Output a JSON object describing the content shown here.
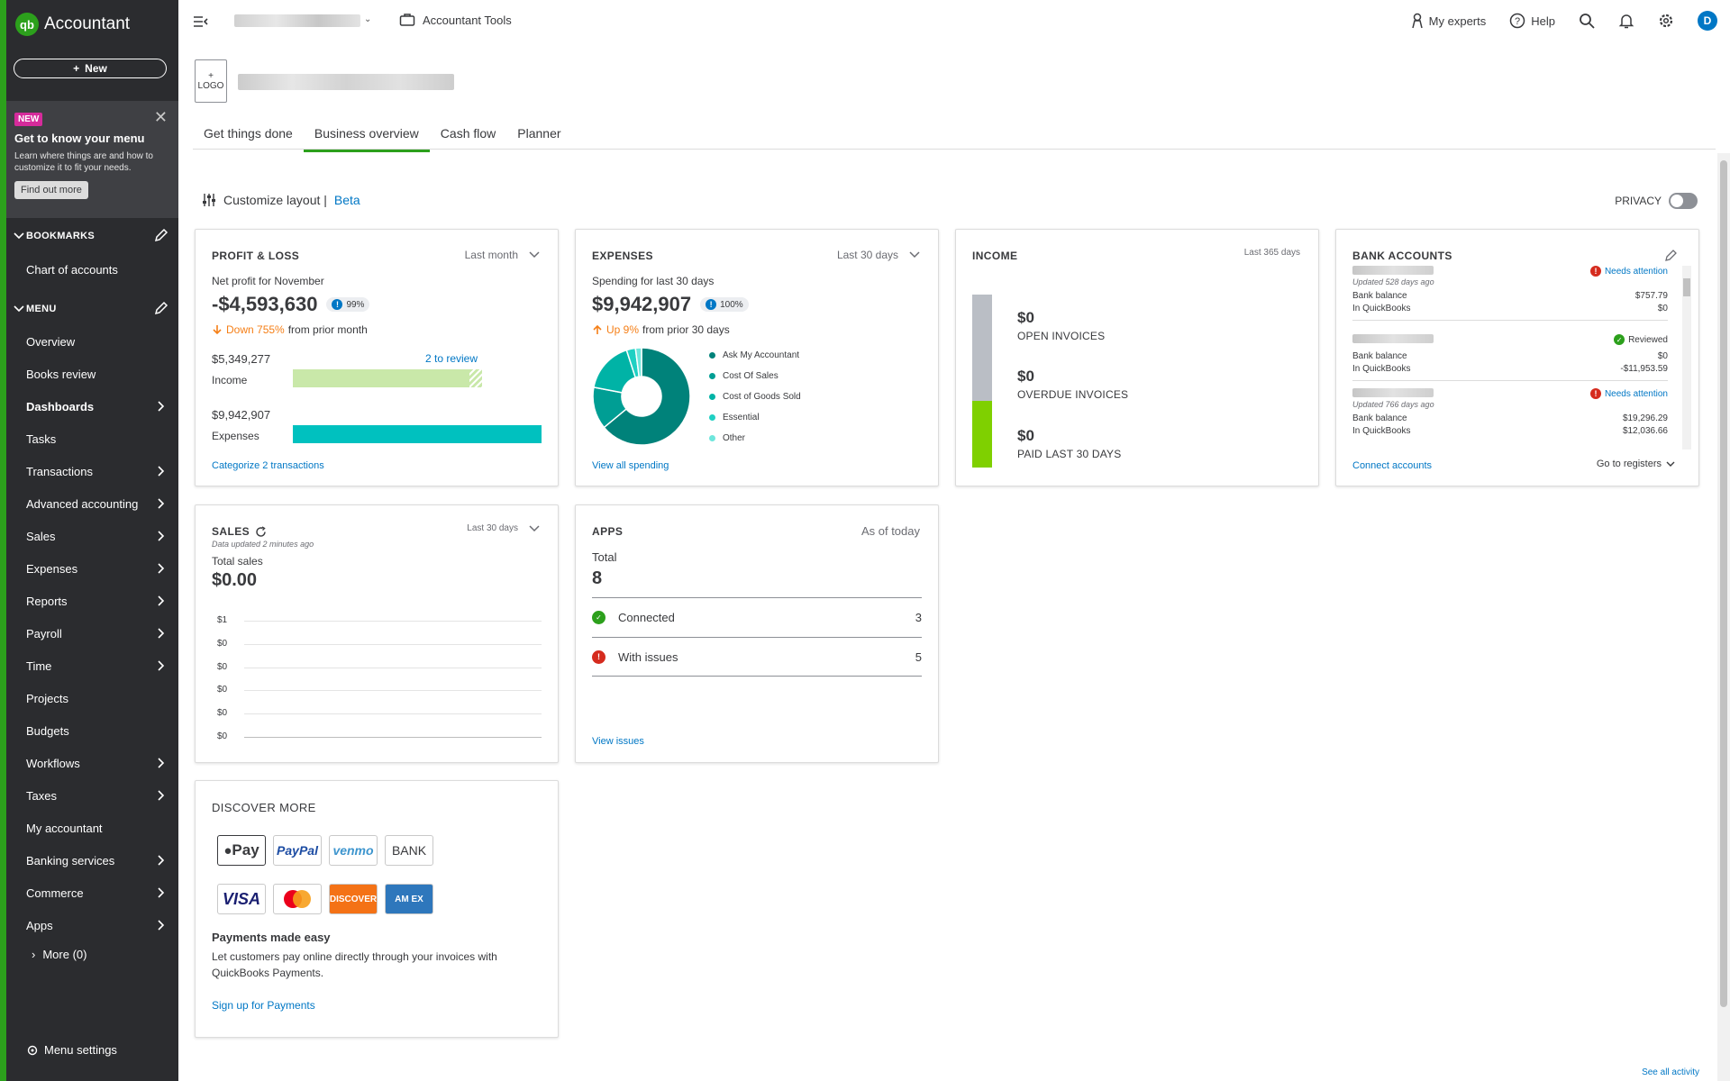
{
  "app": {
    "name": "Accountant",
    "logo_text": "qb"
  },
  "sidebar": {
    "new_label": "New",
    "promo": {
      "badge": "NEW",
      "title": "Get to know your menu",
      "text": "Learn where things are and how to customize it to fit your needs.",
      "button": "Find out more"
    },
    "bookmarks_label": "BOOKMARKS",
    "bookmarks": [
      {
        "label": "Chart of accounts"
      }
    ],
    "menu_label": "MENU",
    "items": [
      {
        "label": "Overview",
        "arrow": false
      },
      {
        "label": "Books review",
        "arrow": false
      },
      {
        "label": "Dashboards",
        "arrow": true,
        "bold": true
      },
      {
        "label": "Tasks",
        "arrow": false
      },
      {
        "label": "Transactions",
        "arrow": true
      },
      {
        "label": "Advanced accounting",
        "arrow": true
      },
      {
        "label": "Sales",
        "arrow": true
      },
      {
        "label": "Expenses",
        "arrow": true
      },
      {
        "label": "Reports",
        "arrow": true
      },
      {
        "label": "Payroll",
        "arrow": true
      },
      {
        "label": "Time",
        "arrow": true
      },
      {
        "label": "Projects",
        "arrow": false
      },
      {
        "label": "Budgets",
        "arrow": false
      },
      {
        "label": "Workflows",
        "arrow": true
      },
      {
        "label": "Taxes",
        "arrow": true
      },
      {
        "label": "My accountant",
        "arrow": false
      },
      {
        "label": "Banking services",
        "arrow": true
      },
      {
        "label": "Commerce",
        "arrow": true
      },
      {
        "label": "Apps",
        "arrow": true
      }
    ],
    "more_label": "More (0)",
    "settings_label": "Menu settings"
  },
  "topbar": {
    "tools_label": "Accountant Tools",
    "my_experts": "My experts",
    "help": "Help",
    "avatar": "D"
  },
  "header": {
    "logo_plus": "+",
    "logo_label": "LOGO",
    "tabs": [
      "Get things done",
      "Business overview",
      "Cash flow",
      "Planner"
    ],
    "active_tab": "Business overview"
  },
  "toolbar": {
    "customize": "Customize layout |",
    "beta": "Beta",
    "privacy": "PRIVACY"
  },
  "profit_loss": {
    "title": "PROFIT & LOSS",
    "period": "Last month",
    "subtitle": "Net profit for November",
    "net": "-$4,593,630",
    "pct": "99%",
    "change": "Down 755%",
    "change_suffix": "from prior month",
    "income_amount": "$5,349,277",
    "income_label": "Income",
    "review": "2 to review",
    "expenses_amount": "$9,942,907",
    "expenses_label": "Expenses",
    "link": "Categorize 2 transactions",
    "income_fill": 0.76,
    "expenses_fill": 1.0
  },
  "expenses": {
    "title": "EXPENSES",
    "period": "Last 30 days",
    "subtitle": "Spending for last 30 days",
    "amount": "$9,942,907",
    "pct": "100%",
    "change": "Up 9%",
    "change_suffix": "from prior 30 days",
    "legend": [
      {
        "label": "Ask My Accountant",
        "color": "#00827a",
        "value": 64
      },
      {
        "label": "Cost Of Sales",
        "color": "#009e94",
        "value": 14
      },
      {
        "label": "Cost of Goods Sold",
        "color": "#00b3a6",
        "value": 17
      },
      {
        "label": "Essential",
        "color": "#1fd0c3",
        "value": 3
      },
      {
        "label": "Other",
        "color": "#6ee6dc",
        "value": 2
      }
    ],
    "link": "View all spending"
  },
  "income": {
    "title": "INCOME",
    "period": "Last 365 days",
    "rows": [
      {
        "amount": "$0",
        "label": "OPEN INVOICES"
      },
      {
        "amount": "$0",
        "label": "OVERDUE INVOICES"
      },
      {
        "amount": "$0",
        "label": "PAID LAST 30 DAYS"
      }
    ],
    "colors": {
      "open": "#babec5",
      "paid": "#7fd000"
    }
  },
  "bank_accounts": {
    "title": "BANK ACCOUNTS",
    "entries": [
      {
        "status": "Needs attention",
        "status_type": "warn",
        "updated": "Updated 528 days ago",
        "bank_label": "Bank balance",
        "bank": "$757.79",
        "qb_label": "In QuickBooks",
        "qb": "$0"
      },
      {
        "status": "Reviewed",
        "status_type": "ok",
        "updated": "",
        "bank_label": "Bank balance",
        "bank": "$0",
        "qb_label": "In QuickBooks",
        "qb": "-$11,953.59"
      },
      {
        "status": "Needs attention",
        "status_type": "warn",
        "updated": "Updated 766 days ago",
        "bank_label": "Bank balance",
        "bank": "$19,296.29",
        "qb_label": "In QuickBooks",
        "qb": "$12,036.66"
      }
    ],
    "connect": "Connect accounts",
    "registers": "Go to registers"
  },
  "sales": {
    "title": "SALES",
    "period": "Last 30 days",
    "updated": "Data updated 2 minutes ago",
    "total_label": "Total sales",
    "total": "$0.00",
    "chart_data": {
      "type": "line",
      "y_ticks": [
        "$1",
        "$0",
        "$0",
        "$0",
        "$0",
        "$0"
      ],
      "values": []
    }
  },
  "apps": {
    "title": "APPS",
    "period": "As of today",
    "total_label": "Total",
    "total": "8",
    "rows": [
      {
        "label": "Connected",
        "count": "3",
        "type": "ok"
      },
      {
        "label": "With issues",
        "count": "5",
        "type": "warn"
      }
    ],
    "link": "View issues"
  },
  "discover": {
    "title": "DISCOVER MORE",
    "logos": [
      "Pay",
      "PayPal",
      "venmo",
      "BANK",
      "VISA",
      "",
      "DISCOVER",
      "AM EX"
    ],
    "heading": "Payments made easy",
    "text": "Let customers pay online directly through your invoices with QuickBooks Payments.",
    "link": "Sign up for Payments"
  },
  "footer": {
    "see_all": "See all activity"
  }
}
